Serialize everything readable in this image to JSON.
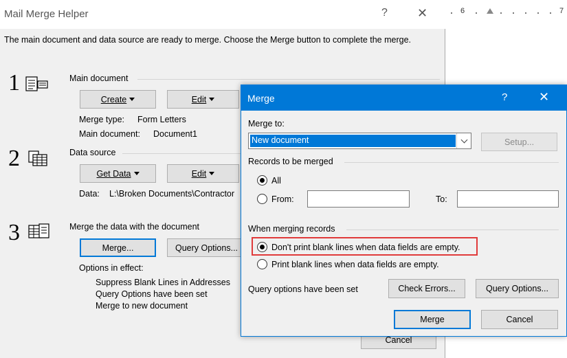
{
  "background": {
    "ruler_numbers": [
      "6",
      "7"
    ]
  },
  "helper": {
    "title": "Mail Merge Helper",
    "help_glyph": "?",
    "close_glyph": "✕",
    "instructions": "The main document and data source are ready to merge. Choose the Merge button to complete the merge.",
    "step1": {
      "number": "1",
      "label": "Main document",
      "create_label": "Create",
      "create_accel": "C",
      "edit_label": "Edit",
      "merge_type_label": "Merge type:",
      "merge_type_value": "Form Letters",
      "main_doc_label": "Main document:",
      "main_doc_value": "Document1"
    },
    "step2": {
      "number": "2",
      "label": "Data source",
      "get_data_label": "Get Data",
      "edit_label": "Edit",
      "data_label": "Data:",
      "data_value": "L:\\Broken Documents\\Contractor"
    },
    "step3": {
      "number": "3",
      "label": "Merge the data with the document",
      "merge_label": "Merge...",
      "query_label": "Query Options...",
      "options_label": "Options in effect:",
      "options": [
        "Suppress Blank Lines in Addresses",
        "Query Options have been set",
        "Merge to new document"
      ]
    },
    "cancel_label": "Cancel"
  },
  "merge_dialog": {
    "title": "Merge",
    "help_glyph": "?",
    "close_glyph": "✕",
    "merge_to_label": "Merge to:",
    "merge_to_value": "New document",
    "setup_label": "Setup...",
    "records_label": "Records to be merged",
    "all_label": "All",
    "from_label": "From:",
    "to_label": "To:",
    "from_value": "",
    "to_value": "",
    "when_merging_label": "When merging records",
    "dont_print_label": "Don't print blank lines when data fields are empty.",
    "print_label": "Print blank lines when data fields are empty.",
    "query_set_label": "Query options have been set",
    "check_errors_label": "Check Errors...",
    "query_options_label": "Query Options...",
    "merge_button_label": "Merge",
    "cancel_button_label": "Cancel"
  },
  "colors": {
    "accent": "#0078d7",
    "highlight": "#e03a3a",
    "dialog_bg": "#f0f0f0"
  }
}
